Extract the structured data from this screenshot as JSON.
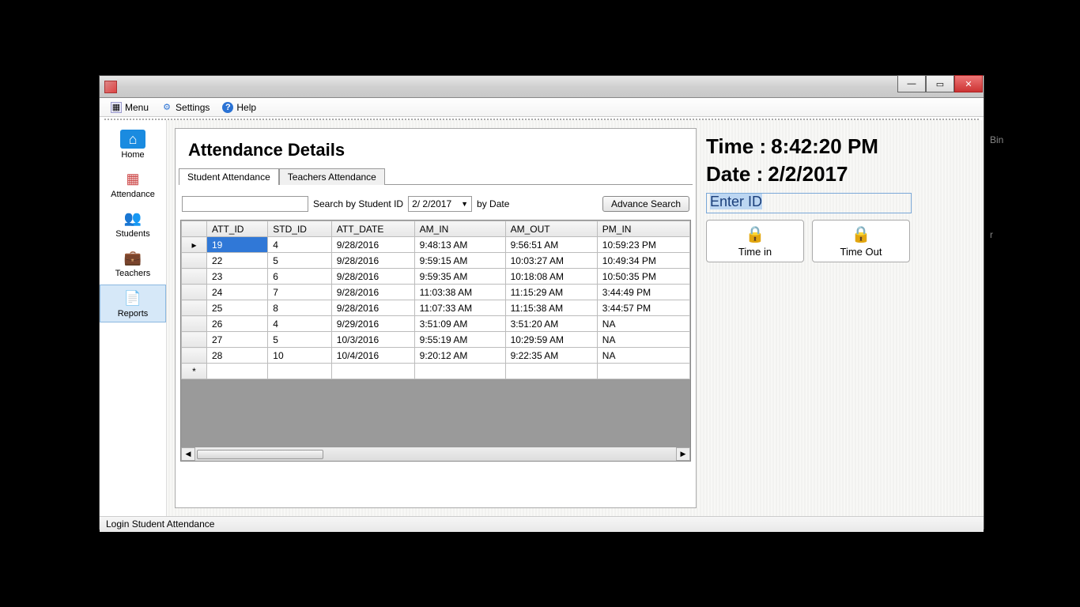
{
  "background": {
    "label1": "Bin",
    "label2": "r"
  },
  "titlebar": {
    "tooltip": ""
  },
  "menu": {
    "menu": "Menu",
    "settings": "Settings",
    "help": "Help"
  },
  "sidebar": {
    "items": [
      {
        "label": "Home",
        "icon": "home"
      },
      {
        "label": "Attendance",
        "icon": "calendar"
      },
      {
        "label": "Students",
        "icon": "students"
      },
      {
        "label": "Teachers",
        "icon": "teachers"
      },
      {
        "label": "Reports",
        "icon": "reports"
      }
    ]
  },
  "panel": {
    "title": "Attendance Details",
    "tabs": {
      "student": "Student Attendance",
      "teacher": "Teachers Attendance"
    },
    "search_label": "Search by Student ID",
    "date_value": "2/ 2/2017",
    "by_date_label": "by Date",
    "advance_btn": "Advance Search",
    "columns": [
      "ATT_ID",
      "STD_ID",
      "ATT_DATE",
      "AM_IN",
      "AM_OUT",
      "PM_IN"
    ],
    "rows": [
      [
        "19",
        "4",
        "9/28/2016",
        "9:48:13 AM",
        "9:56:51 AM",
        "10:59:23 PM"
      ],
      [
        "22",
        "5",
        "9/28/2016",
        "9:59:15 AM",
        "10:03:27 AM",
        "10:49:34 PM"
      ],
      [
        "23",
        "6",
        "9/28/2016",
        "9:59:35 AM",
        "10:18:08 AM",
        "10:50:35 PM"
      ],
      [
        "24",
        "7",
        "9/28/2016",
        "11:03:38 AM",
        "11:15:29 AM",
        "3:44:49 PM"
      ],
      [
        "25",
        "8",
        "9/28/2016",
        "11:07:33 AM",
        "11:15:38 AM",
        "3:44:57 PM"
      ],
      [
        "26",
        "4",
        "9/29/2016",
        "3:51:09 AM",
        "3:51:20 AM",
        "NA"
      ],
      [
        "27",
        "5",
        "10/3/2016",
        "9:55:19 AM",
        "10:29:59 AM",
        "NA"
      ],
      [
        "28",
        "10",
        "10/4/2016",
        "9:20:12 AM",
        "9:22:35 AM",
        "NA"
      ]
    ]
  },
  "right": {
    "time_label": "Time :",
    "time_value": "8:42:20 PM",
    "date_label": "Date :",
    "date_value": "2/2/2017",
    "enter_id": "Enter ID",
    "time_in": "Time in",
    "time_out": "Time Out"
  },
  "status": "Login Student Attendance"
}
